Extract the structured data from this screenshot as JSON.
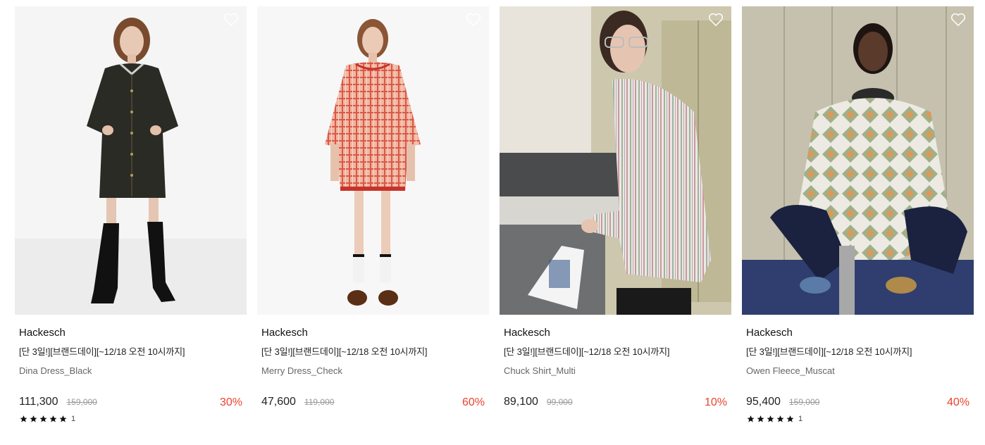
{
  "products": [
    {
      "brand": "Hackesch",
      "promo": "[단 3일!][브랜드데이][~12/18 오전 10시까지]",
      "name": "Dina Dress_Black",
      "price": "111,300",
      "original_price": "159,000",
      "discount": "30%",
      "rating_stars": 5,
      "review_count": "1",
      "image": "model-black-coat-dress"
    },
    {
      "brand": "Hackesch",
      "promo": "[단 3일!][브랜드데이][~12/18 오전 10시까지]",
      "name": "Merry Dress_Check",
      "price": "47,600",
      "original_price": "119,000",
      "discount": "60%",
      "image": "model-red-check-dress"
    },
    {
      "brand": "Hackesch",
      "promo": "[단 3일!][브랜드데이][~12/18 오전 10시까지]",
      "name": "Chuck Shirt_Multi",
      "price": "89,100",
      "original_price": "99,000",
      "discount": "10%",
      "image": "model-striped-shirt-office"
    },
    {
      "brand": "Hackesch",
      "promo": "[단 3일!][브랜드데이][~12/18 오전 10시까지]",
      "name": "Owen Fleece_Muscat",
      "price": "95,400",
      "original_price": "159,000",
      "discount": "40%",
      "rating_stars": 5,
      "review_count": "1",
      "image": "model-fleece-lockers"
    }
  ],
  "colors": {
    "discount": "#e8442d",
    "star": "#111111",
    "heart": "#ffffff"
  },
  "icons": {
    "wishlist": "heart-icon",
    "rating": "star-icon"
  }
}
